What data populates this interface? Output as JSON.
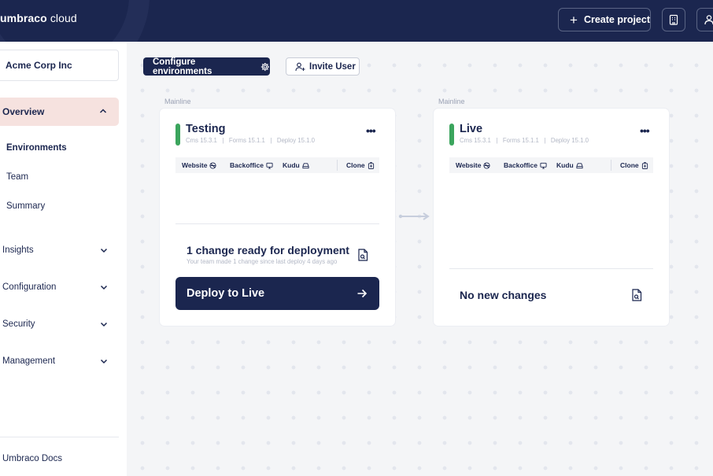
{
  "header": {
    "brand_bold": "umbraco",
    "brand_light": " cloud",
    "create_project_label": "Create project"
  },
  "sidebar": {
    "org_name": "Acme Corp Inc",
    "overview_label": "Overview",
    "sub_items": [
      "Environments",
      "Team",
      "Summary"
    ],
    "nav_items": [
      "Insights",
      "Configuration",
      "Security",
      "Management"
    ],
    "docs_label": "Umbraco Docs"
  },
  "toolbar": {
    "configure_label": "Configure environments",
    "invite_label": "Invite User"
  },
  "environments": [
    {
      "lane": "Mainline",
      "name": "Testing",
      "meta": "Cms 15.3.1   |   Forms 15.1.1   |   Deploy 15.1.0",
      "status_color": "#3ba55d",
      "links": {
        "website": "Website",
        "backoffice": "Backoffice",
        "kudu": "Kudu",
        "clone": "Clone"
      },
      "change_title": "1 change ready for deployment",
      "change_sub": "Your team made 1 change since last deploy 4 days ago",
      "deploy_label": "Deploy to Live"
    },
    {
      "lane": "Mainline",
      "name": "Live",
      "meta": "Cms 15.3.1   |   Forms 15.1.1   |   Deploy 15.1.0",
      "status_color": "#3ba55d",
      "links": {
        "website": "Website",
        "backoffice": "Backoffice",
        "kudu": "Kudu",
        "clone": "Clone"
      },
      "no_changes_label": "No new changes"
    }
  ],
  "colors": {
    "brand_navy": "#1b264f",
    "active_nav_bg": "#f6e2df",
    "status_green": "#3ba55d"
  }
}
